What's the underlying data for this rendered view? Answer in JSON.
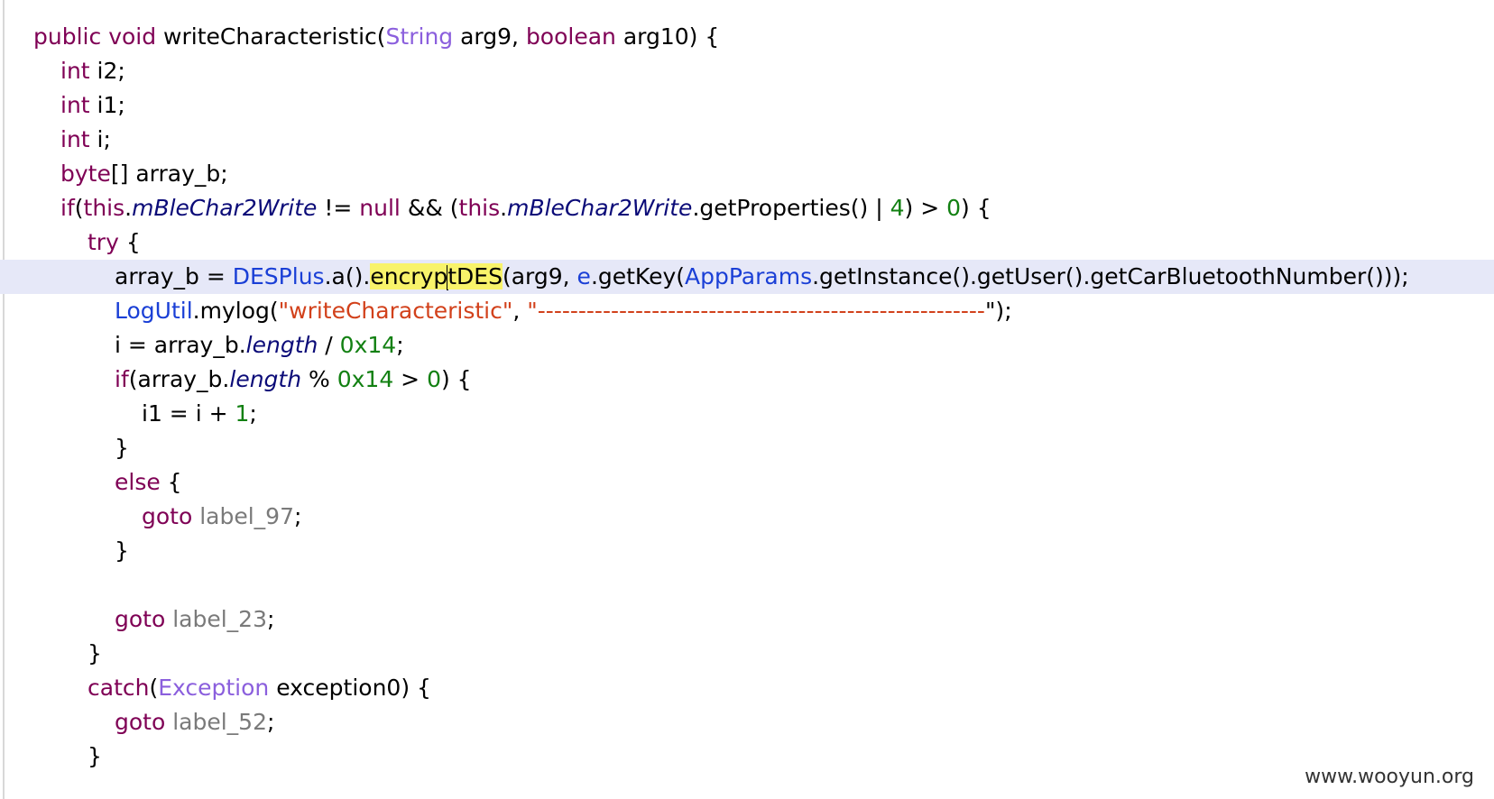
{
  "editor": {
    "lines": [
      {
        "indent": 1,
        "tokens": [
          {
            "t": "public",
            "c": "kw"
          },
          {
            "t": " ",
            "c": "plain"
          },
          {
            "t": "void",
            "c": "kw"
          },
          {
            "t": " writeCharacteristic(",
            "c": "plain"
          },
          {
            "t": "String",
            "c": "type"
          },
          {
            "t": " arg9, ",
            "c": "plain"
          },
          {
            "t": "boolean",
            "c": "kw"
          },
          {
            "t": " arg10) {",
            "c": "plain"
          }
        ]
      },
      {
        "indent": 2,
        "tokens": [
          {
            "t": "int",
            "c": "kw"
          },
          {
            "t": " i2;",
            "c": "plain"
          }
        ]
      },
      {
        "indent": 2,
        "tokens": [
          {
            "t": "int",
            "c": "kw"
          },
          {
            "t": " i1;",
            "c": "plain"
          }
        ]
      },
      {
        "indent": 2,
        "tokens": [
          {
            "t": "int",
            "c": "kw"
          },
          {
            "t": " i;",
            "c": "plain"
          }
        ]
      },
      {
        "indent": 2,
        "tokens": [
          {
            "t": "byte",
            "c": "kw"
          },
          {
            "t": "[] array_b;",
            "c": "plain"
          }
        ]
      },
      {
        "indent": 2,
        "tokens": [
          {
            "t": "if",
            "c": "kw"
          },
          {
            "t": "(",
            "c": "plain"
          },
          {
            "t": "this",
            "c": "kw"
          },
          {
            "t": ".",
            "c": "plain"
          },
          {
            "t": "mBleChar2Write",
            "c": "fld"
          },
          {
            "t": " != ",
            "c": "plain"
          },
          {
            "t": "null",
            "c": "kw"
          },
          {
            "t": " && (",
            "c": "plain"
          },
          {
            "t": "this",
            "c": "kw"
          },
          {
            "t": ".",
            "c": "plain"
          },
          {
            "t": "mBleChar2Write",
            "c": "fld"
          },
          {
            "t": ".getProperties() | ",
            "c": "plain"
          },
          {
            "t": "4",
            "c": "num"
          },
          {
            "t": ") > ",
            "c": "plain"
          },
          {
            "t": "0",
            "c": "num"
          },
          {
            "t": ") {",
            "c": "plain"
          }
        ]
      },
      {
        "indent": 3,
        "tokens": [
          {
            "t": "try",
            "c": "kw"
          },
          {
            "t": " {",
            "c": "plain"
          }
        ]
      },
      {
        "indent": 4,
        "current": true,
        "tokens": [
          {
            "t": "array_b = ",
            "c": "plain"
          },
          {
            "t": "DESPlus",
            "c": "cls"
          },
          {
            "t": ".a().",
            "c": "plain"
          },
          {
            "t": "encryp",
            "c": "plain hl"
          },
          {
            "t": "",
            "c": "caret"
          },
          {
            "t": "tDES",
            "c": "plain hl"
          },
          {
            "t": "(arg9, ",
            "c": "plain"
          },
          {
            "t": "e",
            "c": "cls"
          },
          {
            "t": ".getKey(",
            "c": "plain"
          },
          {
            "t": "AppParams",
            "c": "cls"
          },
          {
            "t": ".getInstance().getUser().getCarBluetoothNumber()));",
            "c": "plain"
          }
        ]
      },
      {
        "indent": 4,
        "tokens": [
          {
            "t": "LogUtil",
            "c": "cls"
          },
          {
            "t": ".mylog(",
            "c": "plain"
          },
          {
            "t": "\"writeCharacteristic\"",
            "c": "str"
          },
          {
            "t": ", ",
            "c": "plain"
          },
          {
            "t": "\"-------------------------------------------------------",
            "c": "str"
          },
          {
            "t": "\");",
            "c": "plain"
          }
        ]
      },
      {
        "indent": 4,
        "tokens": [
          {
            "t": "i = array_b.",
            "c": "plain"
          },
          {
            "t": "length",
            "c": "fld"
          },
          {
            "t": " / ",
            "c": "plain"
          },
          {
            "t": "0x14",
            "c": "num"
          },
          {
            "t": ";",
            "c": "plain"
          }
        ]
      },
      {
        "indent": 4,
        "tokens": [
          {
            "t": "if",
            "c": "kw"
          },
          {
            "t": "(array_b.",
            "c": "plain"
          },
          {
            "t": "length",
            "c": "fld"
          },
          {
            "t": " % ",
            "c": "plain"
          },
          {
            "t": "0x14",
            "c": "num"
          },
          {
            "t": " > ",
            "c": "plain"
          },
          {
            "t": "0",
            "c": "num"
          },
          {
            "t": ") {",
            "c": "plain"
          }
        ]
      },
      {
        "indent": 5,
        "tokens": [
          {
            "t": "i1 = i + ",
            "c": "plain"
          },
          {
            "t": "1",
            "c": "num"
          },
          {
            "t": ";",
            "c": "plain"
          }
        ]
      },
      {
        "indent": 4,
        "tokens": [
          {
            "t": "}",
            "c": "plain"
          }
        ]
      },
      {
        "indent": 4,
        "tokens": [
          {
            "t": "else",
            "c": "kw"
          },
          {
            "t": " {",
            "c": "plain"
          }
        ]
      },
      {
        "indent": 5,
        "tokens": [
          {
            "t": "goto",
            "c": "kw"
          },
          {
            "t": " ",
            "c": "plain"
          },
          {
            "t": "label_97",
            "c": "lbl"
          },
          {
            "t": ";",
            "c": "plain"
          }
        ]
      },
      {
        "indent": 4,
        "tokens": [
          {
            "t": "}",
            "c": "plain"
          }
        ]
      },
      {
        "indent": 0,
        "tokens": []
      },
      {
        "indent": 4,
        "tokens": [
          {
            "t": "goto",
            "c": "kw"
          },
          {
            "t": " ",
            "c": "plain"
          },
          {
            "t": "label_23",
            "c": "lbl"
          },
          {
            "t": ";",
            "c": "plain"
          }
        ]
      },
      {
        "indent": 3,
        "tokens": [
          {
            "t": "}",
            "c": "plain"
          }
        ]
      },
      {
        "indent": 3,
        "tokens": [
          {
            "t": "catch",
            "c": "kw"
          },
          {
            "t": "(",
            "c": "plain"
          },
          {
            "t": "Exception",
            "c": "type"
          },
          {
            "t": " exception0) {",
            "c": "plain"
          }
        ]
      },
      {
        "indent": 4,
        "tokens": [
          {
            "t": "goto",
            "c": "kw"
          },
          {
            "t": " ",
            "c": "plain"
          },
          {
            "t": "label_52",
            "c": "lbl"
          },
          {
            "t": ";",
            "c": "plain"
          }
        ]
      },
      {
        "indent": 3,
        "tokens": [
          {
            "t": "}",
            "c": "plain"
          }
        ]
      }
    ]
  },
  "watermark": {
    "text": "www.wooyun.org"
  }
}
